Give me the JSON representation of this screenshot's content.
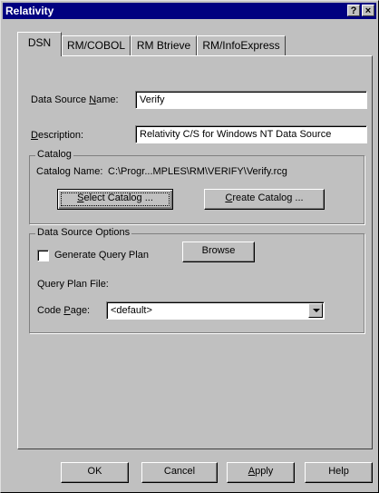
{
  "window": {
    "title": "Relativity",
    "help_button": "?",
    "close_button": "×"
  },
  "tabs": [
    {
      "label": "DSN",
      "active": true
    },
    {
      "label": "RM/COBOL",
      "active": false
    },
    {
      "label": "RM Btrieve",
      "active": false
    },
    {
      "label": "RM/InfoExpress",
      "active": false
    }
  ],
  "dsn": {
    "data_source_name_label_pre": "Data Source ",
    "data_source_name_label_acc": "N",
    "data_source_name_label_post": "ame:",
    "data_source_name_value": "Verify",
    "description_label_acc": "D",
    "description_label_post": "escription:",
    "description_value": "Relativity C/S for Windows NT Data Source"
  },
  "catalog": {
    "group_title": "Catalog",
    "catalog_name_label": "Catalog Name:",
    "catalog_name_value": "C:\\Progr...MPLES\\RM\\VERIFY\\Verify.rcg",
    "select_button_acc": "S",
    "select_button_post": "elect Catalog ...",
    "create_button_acc": "C",
    "create_button_post": "reate Catalog ..."
  },
  "options": {
    "group_title": "Data Source Options",
    "generate_query_plan_label": "Generate Query Plan",
    "generate_query_plan_checked": false,
    "browse_button": "Browse",
    "query_plan_file_label": "Query Plan File:",
    "code_page_label_pre": "Code ",
    "code_page_label_acc": "P",
    "code_page_label_post": "age:",
    "code_page_value": "<default>"
  },
  "footer": {
    "ok": "OK",
    "cancel": "Cancel",
    "apply_acc": "A",
    "apply_post": "pply",
    "help": "Help"
  }
}
